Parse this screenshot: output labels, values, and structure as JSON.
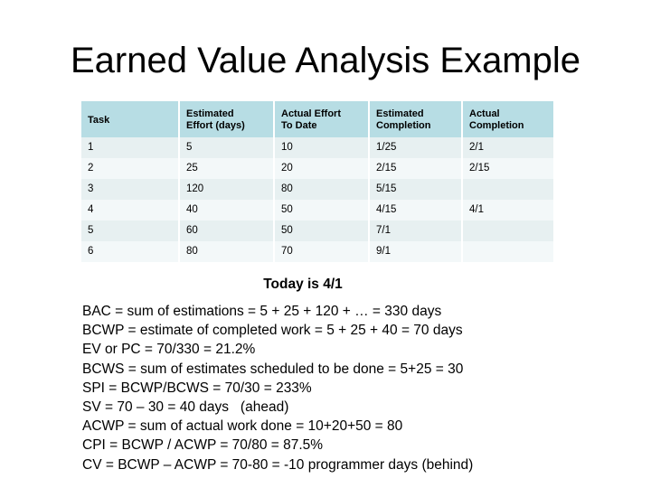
{
  "slide": {
    "title": "Earned Value Analysis Example"
  },
  "table": {
    "columns": [
      {
        "key": "task",
        "header_lines": [
          "Task"
        ]
      },
      {
        "key": "est_effort",
        "header_lines": [
          "Estimated",
          "Effort (days)"
        ]
      },
      {
        "key": "act_effort",
        "header_lines": [
          "Actual Effort",
          "To Date"
        ]
      },
      {
        "key": "est_compl",
        "header_lines": [
          "Estimated",
          "Completion"
        ]
      },
      {
        "key": "act_compl",
        "header_lines": [
          "Actual",
          "Completion"
        ]
      }
    ],
    "rows": [
      {
        "task": "1",
        "est_effort": "5",
        "act_effort": "10",
        "est_compl": "1/25",
        "act_compl": "2/1"
      },
      {
        "task": "2",
        "est_effort": "25",
        "act_effort": "20",
        "est_compl": "2/15",
        "act_compl": "2/15"
      },
      {
        "task": "3",
        "est_effort": "120",
        "act_effort": "80",
        "est_compl": "5/15",
        "act_compl": ""
      },
      {
        "task": "4",
        "est_effort": "40",
        "act_effort": "50",
        "est_compl": "4/15",
        "act_compl": "4/1"
      },
      {
        "task": "5",
        "est_effort": "60",
        "act_effort": "50",
        "est_compl": "7/1",
        "act_compl": ""
      },
      {
        "task": "6",
        "est_effort": "80",
        "act_effort": "70",
        "est_compl": "9/1",
        "act_compl": ""
      }
    ]
  },
  "today_note": "Today is 4/1",
  "formulas": [
    "BAC = sum of estimations = 5 + 25 + 120 + … = 330 days",
    "BCWP = estimate of completed work = 5 + 25 + 40 = 70 days",
    "EV or PC = 70/330 = 21.2%",
    "BCWS = sum of estimates scheduled to be done = 5+25 = 30",
    "SPI = BCWP/BCWS = 70/30 = 233%",
    "SV = 70 – 30 = 40 days   (ahead)",
    "ACWP = sum of actual work done = 10+20+50 = 80",
    "CPI = BCWP / ACWP = 70/80 = 87.5%",
    "CV = BCWP – ACWP = 70-80 = -10 programmer days (behind)"
  ],
  "colors": {
    "header_bg": "#b7dde4",
    "row_odd_bg": "#e7f0f1",
    "row_even_bg": "#f3f8f9",
    "text": "#000000",
    "page_bg": "#ffffff"
  }
}
